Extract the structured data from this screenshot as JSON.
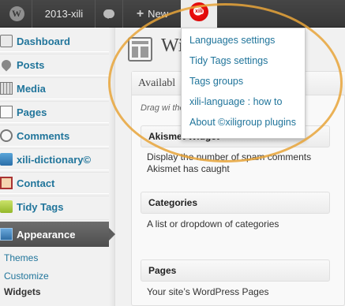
{
  "adminbar": {
    "wp_logo": "W",
    "site_name": "2013-xili",
    "new_label": "New",
    "xili_logo_text": "xili"
  },
  "xili_menu": {
    "items": [
      {
        "label": "Languages settings"
      },
      {
        "label": "Tidy Tags settings"
      },
      {
        "label": "Tags groups"
      },
      {
        "label": "xili-language : how to"
      },
      {
        "label": "About ©xiligroup plugins"
      }
    ]
  },
  "sidebar": {
    "items": [
      {
        "label": "Dashboard",
        "icon": "dashboard-icon"
      },
      {
        "label": "Posts",
        "icon": "pin-icon"
      },
      {
        "label": "Media",
        "icon": "media-icon"
      },
      {
        "label": "Pages",
        "icon": "pages-icon"
      },
      {
        "label": "Comments",
        "icon": "comments-icon"
      },
      {
        "label": "xili-dictionary©",
        "icon": "dictionary-icon"
      },
      {
        "label": "Contact",
        "icon": "contact-icon"
      },
      {
        "label": "Tidy Tags",
        "icon": "tidy-tags-icon"
      }
    ],
    "appearance": {
      "label": "Appearance",
      "icon": "appearance-icon"
    },
    "submenu": [
      {
        "label": "Themes"
      },
      {
        "label": "Customize"
      },
      {
        "label": "Widgets",
        "current": true
      }
    ]
  },
  "main": {
    "page_title": "Wi",
    "available_header": "Availabl",
    "drag_note": "Drag wi                                         the righ",
    "widgets": [
      {
        "title": "Akismet Widget",
        "desc": "Display the number of spam comments Akismet has caught"
      },
      {
        "title": "Categories",
        "desc": "A list or dropdown of categories"
      },
      {
        "title": "Pages",
        "desc": "Your site’s WordPress Pages"
      }
    ]
  },
  "colors": {
    "link": "#21759b",
    "adminbar_bg": "#464646",
    "highlight_ring": "#e8a43a",
    "current_menu_bg": "#5d5d5d"
  }
}
